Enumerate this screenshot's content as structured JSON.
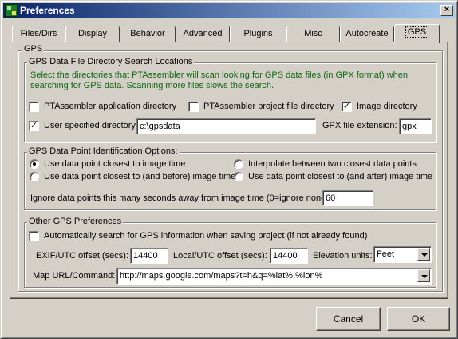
{
  "window": {
    "title": "Preferences",
    "close_glyph": "×"
  },
  "tabs": [
    {
      "label": "Files/Dirs"
    },
    {
      "label": "Display"
    },
    {
      "label": "Behavior"
    },
    {
      "label": "Advanced"
    },
    {
      "label": "Plugins"
    },
    {
      "label": "Misc"
    },
    {
      "label": "Autocreate"
    },
    {
      "label": "GPS",
      "active": true
    }
  ],
  "gps": {
    "outer_label": "GPS",
    "search": {
      "label": "GPS Data File Directory Search Locations",
      "description": "Select the directories that PTAssembler will scan looking for GPS data files (in GPX format) when searching for GPS data.  Scanning more files slows the search.",
      "app_dir_label": "PTAssembler application directory",
      "app_dir_checked": false,
      "project_dir_label": "PTAssembler project file directory",
      "project_dir_checked": false,
      "image_dir_label": "Image directory",
      "image_dir_checked": true,
      "user_dir_label": "User specified directory:",
      "user_dir_checked": true,
      "user_dir_value": "c:\\gpsdata",
      "gpx_ext_label": "GPX file extension:",
      "gpx_ext_value": "gpx"
    },
    "identify": {
      "label": "GPS Data Point Identification Options:",
      "opt_closest": "Use data point closest to image time",
      "opt_interpolate": "Interpolate between two closest data points",
      "opt_before": "Use data point closest to (and before) image time",
      "opt_after": "Use data point closest to (and after) image time",
      "selected": "opt_closest",
      "ignore_label": "Ignore data points this many seconds away from  image time (0=ignore none):",
      "ignore_value": "60"
    },
    "other": {
      "label": "Other GPS Preferences",
      "auto_search_label": "Automatically search for GPS information when saving project (if not already found)",
      "auto_search_checked": false,
      "exif_label": "EXIF/UTC offset (secs):",
      "exif_value": "14400",
      "local_label": "Local/UTC offset (secs):",
      "local_value": "14400",
      "elev_label": "Elevation units:",
      "elev_value": "Feet",
      "map_label": "Map URL/Command:",
      "map_value": "http://maps.google.com/maps?t=h&q=%lat%,%lon%"
    }
  },
  "buttons": {
    "cancel": "Cancel",
    "ok": "OK"
  },
  "icons": {
    "check": "✓",
    "app": "ptassembler-app-icon",
    "close": "close-icon",
    "dropdown": "chevron-down-icon"
  }
}
